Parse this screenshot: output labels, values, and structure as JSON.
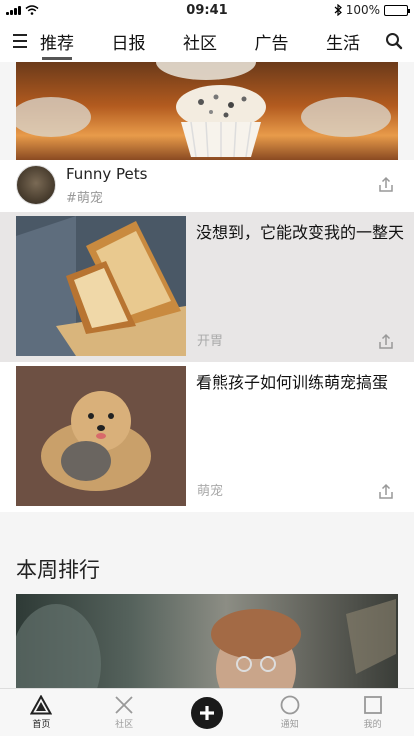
{
  "status_bar": {
    "time": "09:41",
    "battery": "100%",
    "battery_level": 1.0
  },
  "nav": {
    "tabs": [
      "推荐",
      "日报",
      "社区",
      "广告",
      "生活"
    ],
    "active_tab": 0
  },
  "feed": {
    "top_post": {
      "author": "Funny Pets",
      "tag": "#萌宠"
    },
    "cards": [
      {
        "title": "没想到，它能改变我的一整天",
        "tag": "开胃"
      },
      {
        "title": "看熊孩子如何训练萌宠搞蛋",
        "tag": "萌宠"
      }
    ],
    "section_title": "本周排行"
  },
  "tab_bar": {
    "items": [
      {
        "label": "首页",
        "icon": "triangle-icon",
        "active": true
      },
      {
        "label": "社区",
        "icon": "cross-icon",
        "active": false
      },
      {
        "label": "",
        "icon": "add-icon",
        "active": false
      },
      {
        "label": "通知",
        "icon": "circle-icon",
        "active": false
      },
      {
        "label": "我的",
        "icon": "square-icon",
        "active": false
      }
    ]
  }
}
